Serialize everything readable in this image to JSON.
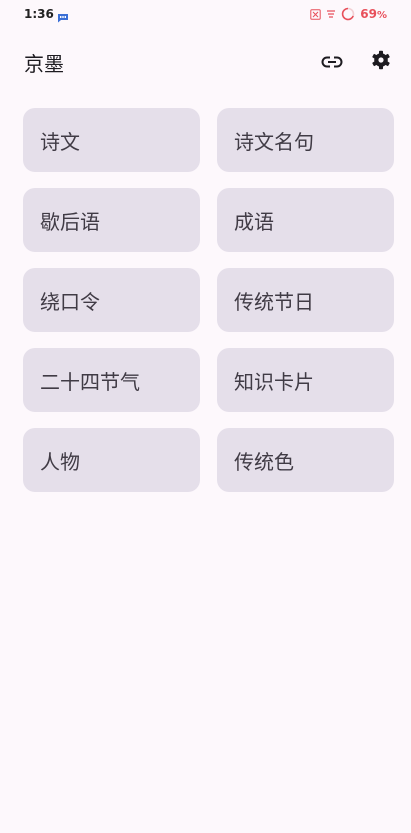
{
  "status_bar": {
    "time": "1:36",
    "battery_percent": "69",
    "battery_unit": "%",
    "battery_color": "#e8505b",
    "icons": [
      "message-icon",
      "sim-off-icon",
      "wifi-icon",
      "battery-ring-icon"
    ]
  },
  "app_bar": {
    "title": "京墨",
    "actions": [
      "link-icon",
      "settings-gear-icon"
    ]
  },
  "menu": {
    "items": [
      {
        "label": "诗文"
      },
      {
        "label": "诗文名句"
      },
      {
        "label": "歇后语"
      },
      {
        "label": "成语"
      },
      {
        "label": "绕口令"
      },
      {
        "label": "传统节日"
      },
      {
        "label": "二十四节气"
      },
      {
        "label": "知识卡片"
      },
      {
        "label": "人物"
      },
      {
        "label": "传统色"
      }
    ]
  },
  "colors": {
    "background": "#fdf8fc",
    "card": "#e5dfea",
    "card_text": "#403b45"
  }
}
